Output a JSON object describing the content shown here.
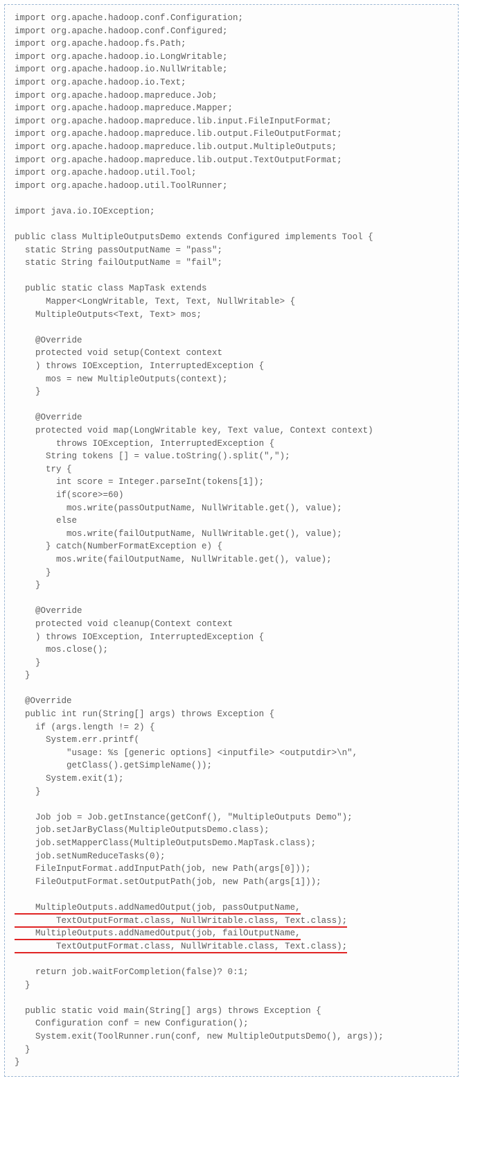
{
  "code": {
    "imports": [
      "import org.apache.hadoop.conf.Configuration;",
      "import org.apache.hadoop.conf.Configured;",
      "import org.apache.hadoop.fs.Path;",
      "import org.apache.hadoop.io.LongWritable;",
      "import org.apache.hadoop.io.NullWritable;",
      "import org.apache.hadoop.io.Text;",
      "import org.apache.hadoop.mapreduce.Job;",
      "import org.apache.hadoop.mapreduce.Mapper;",
      "import org.apache.hadoop.mapreduce.lib.input.FileInputFormat;",
      "import org.apache.hadoop.mapreduce.lib.output.FileOutputFormat;",
      "import org.apache.hadoop.mapreduce.lib.output.MultipleOutputs;",
      "import org.apache.hadoop.mapreduce.lib.output.TextOutputFormat;",
      "import org.apache.hadoop.util.Tool;",
      "import org.apache.hadoop.util.ToolRunner;",
      "",
      "import java.io.IOException;"
    ],
    "class_decl": "public class MultipleOutputsDemo extends Configured implements Tool {",
    "static_fields": [
      "  static String passOutputName = \"pass\";",
      "  static String failOutputName = \"fail\";"
    ],
    "inner_class_open": [
      "  public static class MapTask extends",
      "      Mapper<LongWritable, Text, Text, NullWritable> {",
      "    MultipleOutputs<Text, Text> mos;"
    ],
    "setup": [
      "    @Override",
      "    protected void setup(Context context",
      "    ) throws IOException, InterruptedException {",
      "      mos = new MultipleOutputs(context);",
      "    }"
    ],
    "map": [
      "    @Override",
      "    protected void map(LongWritable key, Text value, Context context)",
      "        throws IOException, InterruptedException {",
      "      String tokens [] = value.toString().split(\",\");",
      "      try {",
      "        int score = Integer.parseInt(tokens[1]);",
      "        if(score>=60)",
      "          mos.write(passOutputName, NullWritable.get(), value);",
      "        else",
      "          mos.write(failOutputName, NullWritable.get(), value);",
      "      } catch(NumberFormatException e) {",
      "        mos.write(failOutputName, NullWritable.get(), value);",
      "      }",
      "    }"
    ],
    "cleanup": [
      "    @Override",
      "    protected void cleanup(Context context",
      "    ) throws IOException, InterruptedException {",
      "      mos.close();",
      "    }",
      "  }"
    ],
    "run_top": [
      "  @Override",
      "  public int run(String[] args) throws Exception {",
      "    if (args.length != 2) {",
      "      System.err.printf(",
      "          \"usage: %s [generic options] <inputfile> <outputdir>\\n\",",
      "          getClass().getSimpleName());",
      "      System.exit(1);",
      "    }",
      "",
      "    Job job = Job.getInstance(getConf(), \"MultipleOutputs Demo\");",
      "    job.setJarByClass(MultipleOutputsDemo.class);",
      "    job.setMapperClass(MultipleOutputsDemo.MapTask.class);",
      "    job.setNumReduceTasks(0);",
      "    FileInputFormat.addInputPath(job, new Path(args[0]));",
      "    FileOutputFormat.setOutputPath(job, new Path(args[1]));",
      ""
    ],
    "highlighted": [
      "    MultipleOutputs.addNamedOutput(job, passOutputName,",
      "        TextOutputFormat.class, NullWritable.class, Text.class);",
      "    MultipleOutputs.addNamedOutput(job, failOutputName,",
      "        TextOutputFormat.class, NullWritable.class, Text.class);"
    ],
    "run_bottom": [
      "",
      "    return job.waitForCompletion(false)? 0:1;",
      "  }"
    ],
    "main": [
      "  public static void main(String[] args) throws Exception {",
      "    Configuration conf = new Configuration();",
      "    System.exit(ToolRunner.run(conf, new MultipleOutputsDemo(), args));",
      "  }",
      "}"
    ]
  }
}
